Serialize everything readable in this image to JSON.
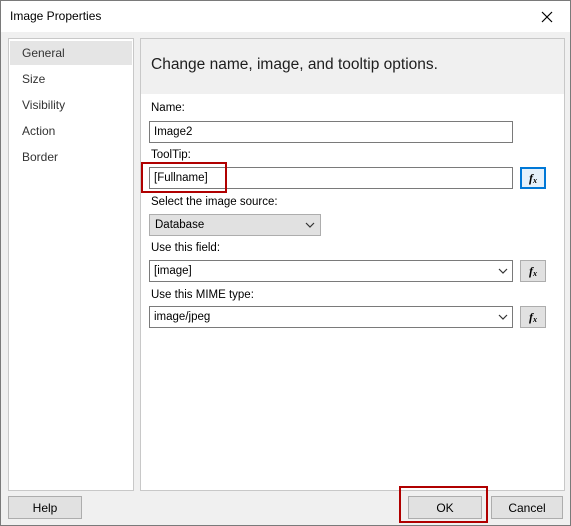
{
  "window": {
    "title": "Image Properties",
    "close_icon": "close-icon"
  },
  "sidebar": {
    "items": [
      {
        "label": "General",
        "selected": true
      },
      {
        "label": "Size",
        "selected": false
      },
      {
        "label": "Visibility",
        "selected": false
      },
      {
        "label": "Action",
        "selected": false
      },
      {
        "label": "Border",
        "selected": false
      }
    ]
  },
  "main": {
    "heading": "Change name, image, and tooltip options.",
    "name_label": "Name:",
    "name_value": "Image2",
    "tooltip_label": "ToolTip:",
    "tooltip_value": "[Fullname]",
    "source_label": "Select the image source:",
    "source_value": "Database",
    "field_label": "Use this field:",
    "field_value": "[image]",
    "mime_label": "Use this MIME type:",
    "mime_value": "image/jpeg",
    "fx_icon": "function-fx-icon"
  },
  "footer": {
    "help_label": "Help",
    "ok_label": "OK",
    "cancel_label": "Cancel"
  },
  "colors": {
    "highlight": "#b00000",
    "focus": "#0078d7"
  }
}
